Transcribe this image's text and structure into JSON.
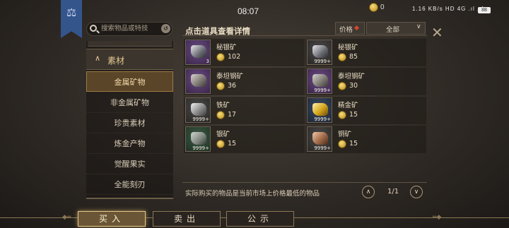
{
  "status": {
    "time": "08:07",
    "coins": "0",
    "net_icons": "1.16 KB/s  HD  4G  .ıl  .ıl",
    "battery": "88"
  },
  "search": {
    "placeholder": "搜索物品或特技"
  },
  "categories": {
    "group": "素材",
    "items": [
      {
        "label": "金属矿物",
        "active": true
      },
      {
        "label": "非金属矿物"
      },
      {
        "label": "珍贵素材"
      },
      {
        "label": "炼金产物"
      },
      {
        "label": "觉醒果实"
      },
      {
        "label": "全能刻刃"
      }
    ]
  },
  "header": {
    "title": "点击道具查看详情",
    "sort_label": "价格",
    "filter_label": "全部"
  },
  "items": [
    {
      "name": "秘银矿",
      "price": "102",
      "qty": "3",
      "bg": "purple",
      "rock": "silverore"
    },
    {
      "name": "秘银矿",
      "price": "85",
      "qty": "9999+",
      "bg": "gray",
      "rock": "silverore"
    },
    {
      "name": "泰坦钢矿",
      "price": "36",
      "qty": "",
      "bg": "purple",
      "rock": "steel"
    },
    {
      "name": "泰坦钢矿",
      "price": "30",
      "qty": "9999+",
      "bg": "purple",
      "rock": "steel"
    },
    {
      "name": "铁矿",
      "price": "17",
      "qty": "9999+",
      "bg": "gray",
      "rock": "iron"
    },
    {
      "name": "精金矿",
      "price": "15",
      "qty": "9999+",
      "bg": "blue",
      "rock": "gold"
    },
    {
      "name": "银矿",
      "price": "15",
      "qty": "9999+",
      "bg": "green",
      "rock": "silver"
    },
    {
      "name": "铜矿",
      "price": "15",
      "qty": "9999+",
      "bg": "gray",
      "rock": "copper"
    }
  ],
  "footer": {
    "note": "实际购买的物品是当前市场上价格最低的物品",
    "page": "1/1"
  },
  "tabs": [
    {
      "label": "买入",
      "active": true
    },
    {
      "label": "卖出"
    },
    {
      "label": "公示"
    }
  ],
  "icons": {
    "search": "search-icon",
    "close": "close-icon",
    "banner": "scales-icon",
    "coin": "gold-coin-icon"
  }
}
